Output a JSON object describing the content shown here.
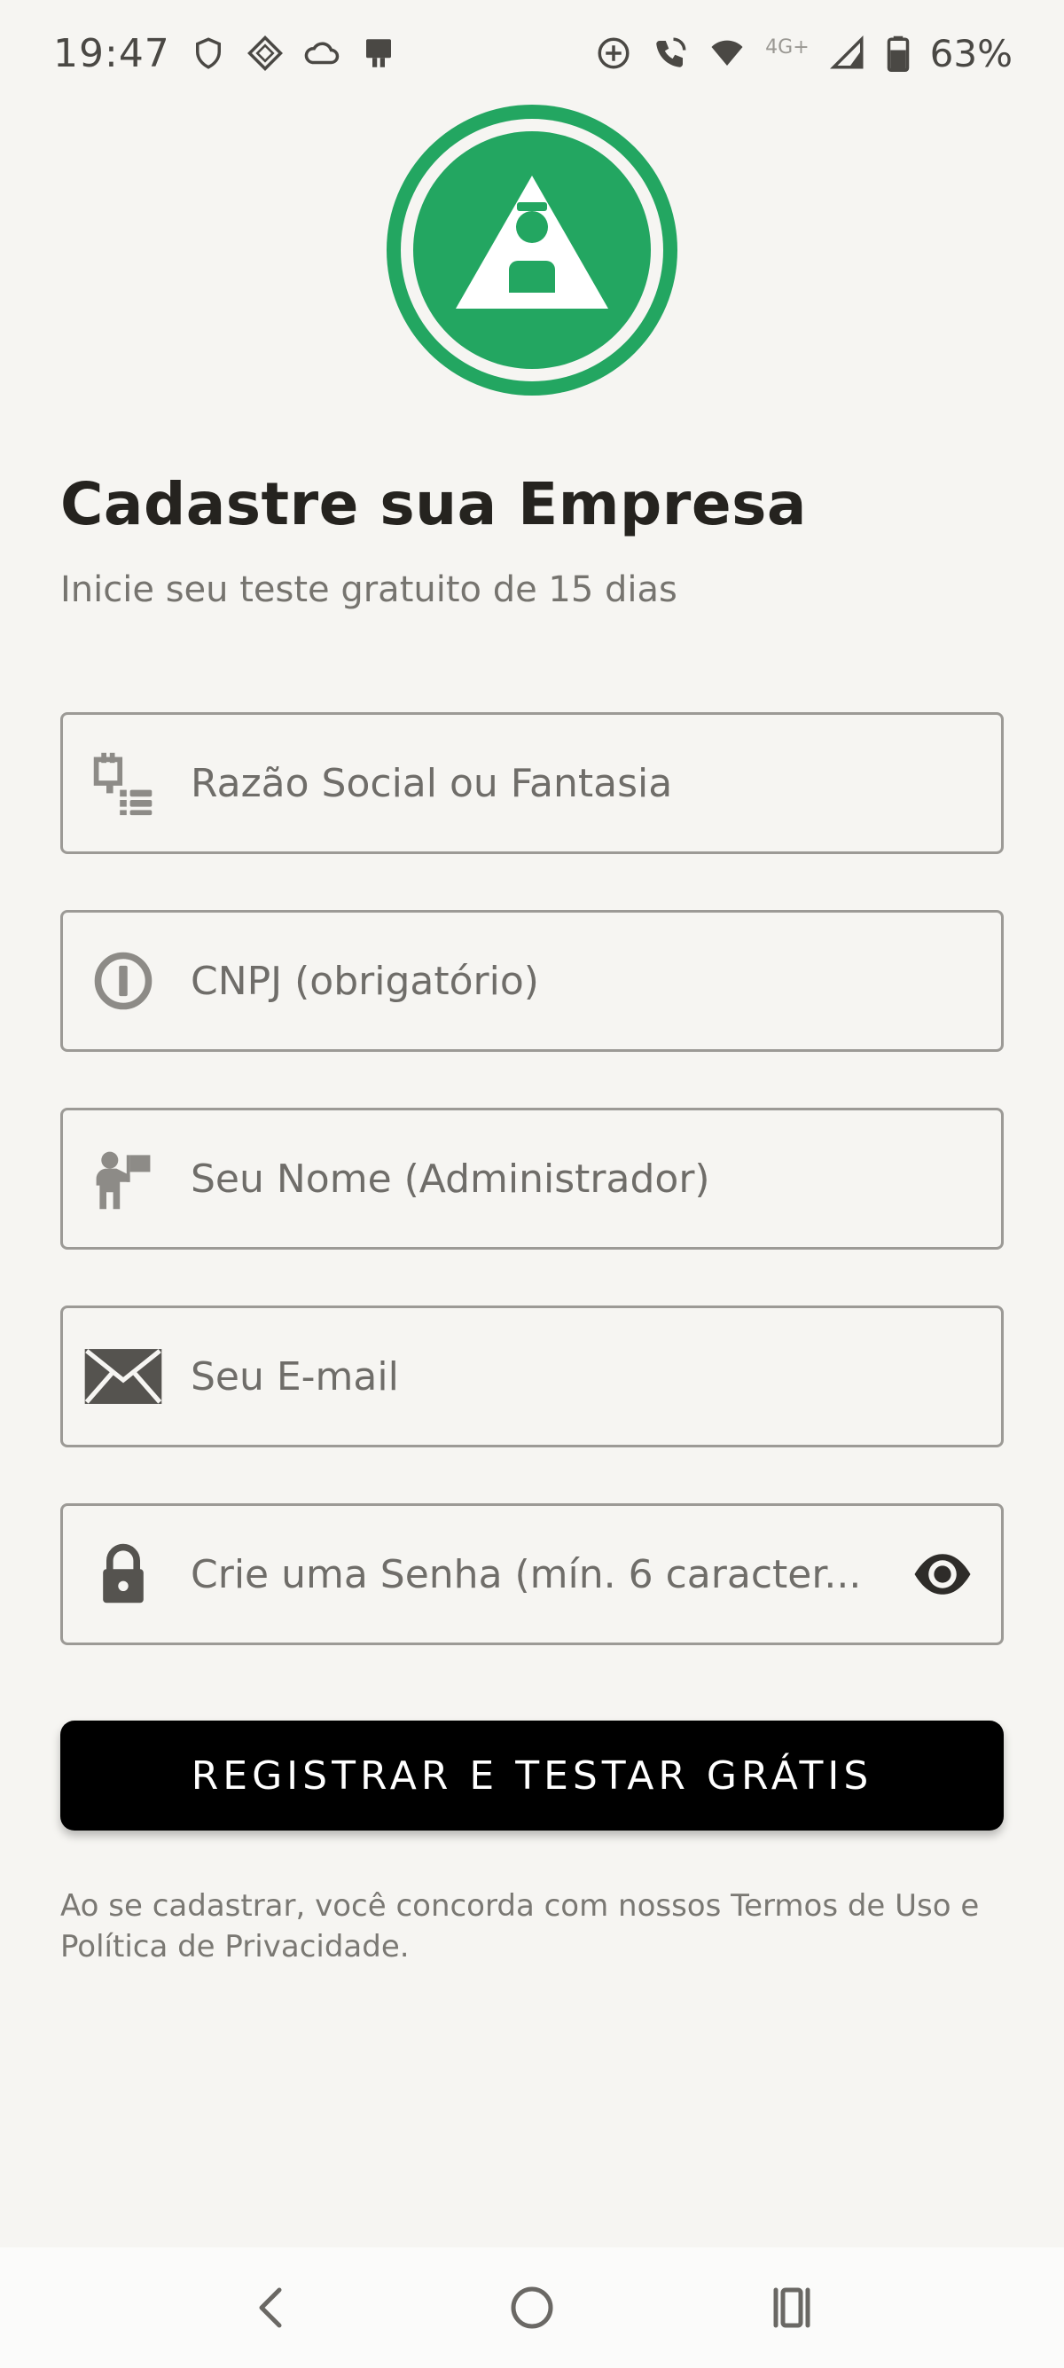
{
  "status_bar": {
    "time": "19:47",
    "network_label": "4G+",
    "battery_percent": "63%",
    "icons": [
      "shield-icon",
      "location-diamond-icon",
      "cloud-icon",
      "tablet-icon",
      "add-circle-icon",
      "wifi-call-icon",
      "wifi-icon",
      "signal-icon",
      "battery-icon"
    ]
  },
  "logo": {
    "icon": "user-triangle-logo",
    "color": "#23a661"
  },
  "header": {
    "title": "Cadastre sua Empresa",
    "subtitle": "Inicie seu teste gratuito de 15 dias"
  },
  "form": {
    "company": {
      "placeholder": "Razão Social ou Fantasia",
      "value": "",
      "icon": "building-icon"
    },
    "cnpj": {
      "placeholder": "CNPJ (obrigatório)",
      "value": "",
      "icon": "info-icon"
    },
    "name": {
      "placeholder": "Seu Nome (Administrador)",
      "value": "",
      "icon": "presenter-icon"
    },
    "email": {
      "placeholder": "Seu E-mail",
      "value": "",
      "icon": "envelope-icon"
    },
    "password": {
      "placeholder": "Crie uma Senha (mín. 6 caracter...",
      "value": "",
      "icon": "lock-icon",
      "toggle_icon": "eye-icon"
    }
  },
  "actions": {
    "register_label": "REGISTRAR E TESTAR GRÁTIS"
  },
  "terms": {
    "text": "Ao se cadastrar, você concorda com nossos Termos de Uso e Política de Privacidade."
  },
  "nav": {
    "icons": [
      "back-icon",
      "home-icon",
      "recents-icon"
    ]
  },
  "colors": {
    "accent": "#23a661",
    "background": "#f6f5f2",
    "button": "#000000",
    "border": "#9c9a96"
  }
}
